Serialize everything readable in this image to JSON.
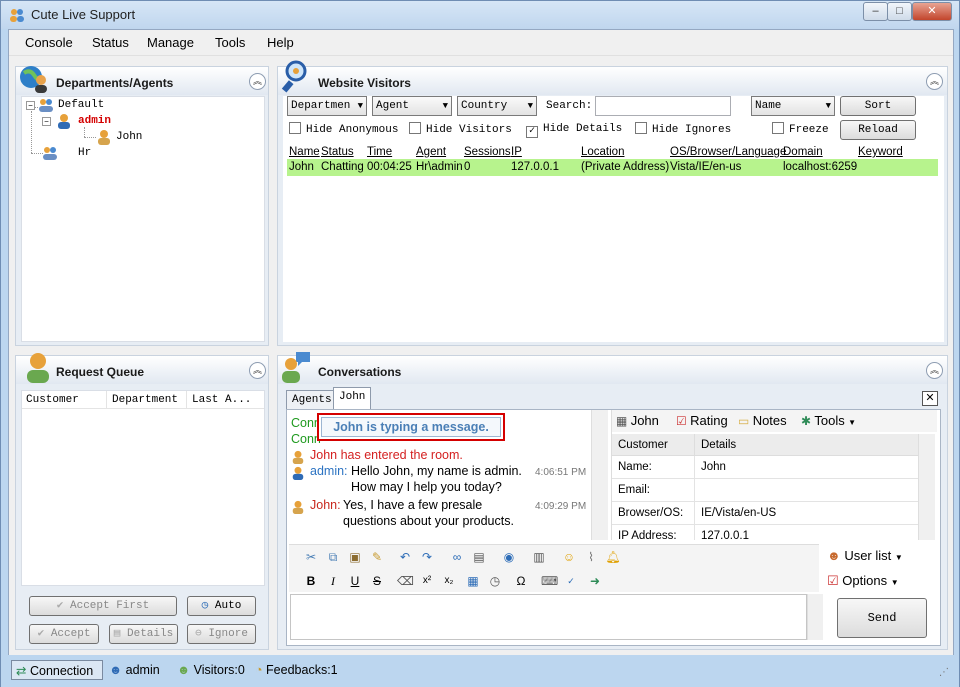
{
  "window": {
    "title": "Cute Live Support",
    "min": "–",
    "max": "□",
    "close": "✕"
  },
  "menu": [
    "Console",
    "Status",
    "Manage",
    "Tools",
    "Help"
  ],
  "departments": {
    "title": "Departments/Agents",
    "tree": [
      {
        "label": "Default"
      },
      {
        "label": "admin"
      },
      {
        "label": "John"
      },
      {
        "label": "Hr"
      }
    ]
  },
  "visitors": {
    "title": "Website Visitors",
    "filters": {
      "department": "Departmen",
      "agent": "Agent",
      "country": "Country",
      "search_label": "Search:",
      "search_value": "",
      "sort_by": "Name"
    },
    "buttons": {
      "sort": "Sort",
      "reload": "Reload"
    },
    "checks": [
      {
        "label": "Hide Anonymous",
        "checked": false
      },
      {
        "label": "Hide Visitors",
        "checked": false
      },
      {
        "label": "Hide Details",
        "checked": true
      },
      {
        "label": "Hide Ignores",
        "checked": false
      },
      {
        "label": "Freeze",
        "checked": false
      }
    ],
    "columns": [
      "Name",
      "Status",
      "Time",
      "Agent",
      "Sessions",
      "IP",
      "Location",
      "OS/Browser/Language",
      "Domain",
      "Keyword"
    ],
    "rows": [
      {
        "name": "John",
        "status": "Chatting",
        "time": "00:04:25",
        "agent": "Hr\\admin",
        "sessions": "0",
        "ip": "127.0.0.1",
        "location": "(Private Address)",
        "os": "Vista/IE/en-us",
        "domain": "localhost:6259",
        "keyword": ""
      }
    ]
  },
  "queue": {
    "title": "Request Queue",
    "columns": [
      "Customer",
      "Department",
      "Last A..."
    ],
    "buttons": {
      "accept_first": "Accept First",
      "auto": "Auto",
      "accept": "Accept",
      "details": "Details",
      "ignore": "Ignore"
    }
  },
  "conversations": {
    "title": "Conversations",
    "tabs": [
      "Agents",
      "John"
    ],
    "typing": "John is typing a message.",
    "lines": [
      {
        "text": "Conn"
      },
      {
        "text": "Conn"
      },
      {
        "text": "John has entered the room."
      },
      {
        "who": "admin:",
        "text1": "Hello John, my name is admin.",
        "text2": "How may I help you today?",
        "time": "4:06:51 PM"
      },
      {
        "who": "John:",
        "text1": "Yes, I have a few presale",
        "text2": "questions about your products.",
        "time": "4:09:29 PM"
      }
    ],
    "side_toolbar": {
      "john": "John",
      "rating": "Rating",
      "notes": "Notes",
      "tools": "Tools"
    },
    "details": {
      "header": [
        "Customer",
        "Details"
      ],
      "rows": [
        {
          "k": "Name:",
          "v": "John"
        },
        {
          "k": "Email:",
          "v": ""
        },
        {
          "k": "Browser/OS:",
          "v": "IE/Vista/en-US"
        },
        {
          "k": "IP Address:",
          "v": "127.0.0.1"
        }
      ]
    },
    "user_list": "User list",
    "options": "Options",
    "send": "Send",
    "message": ""
  },
  "statusbar": {
    "connection": "Connection",
    "user": "admin",
    "visitors": "Visitors:0",
    "feedbacks": "Feedbacks:1"
  },
  "colors": {
    "highlight_row": "#b7f38d",
    "typing_border": "#d40000",
    "system_text": "#d42020",
    "admin_text": "#2c73c2",
    "john_text": "#c8281e",
    "connected": "#1f9a1f"
  }
}
